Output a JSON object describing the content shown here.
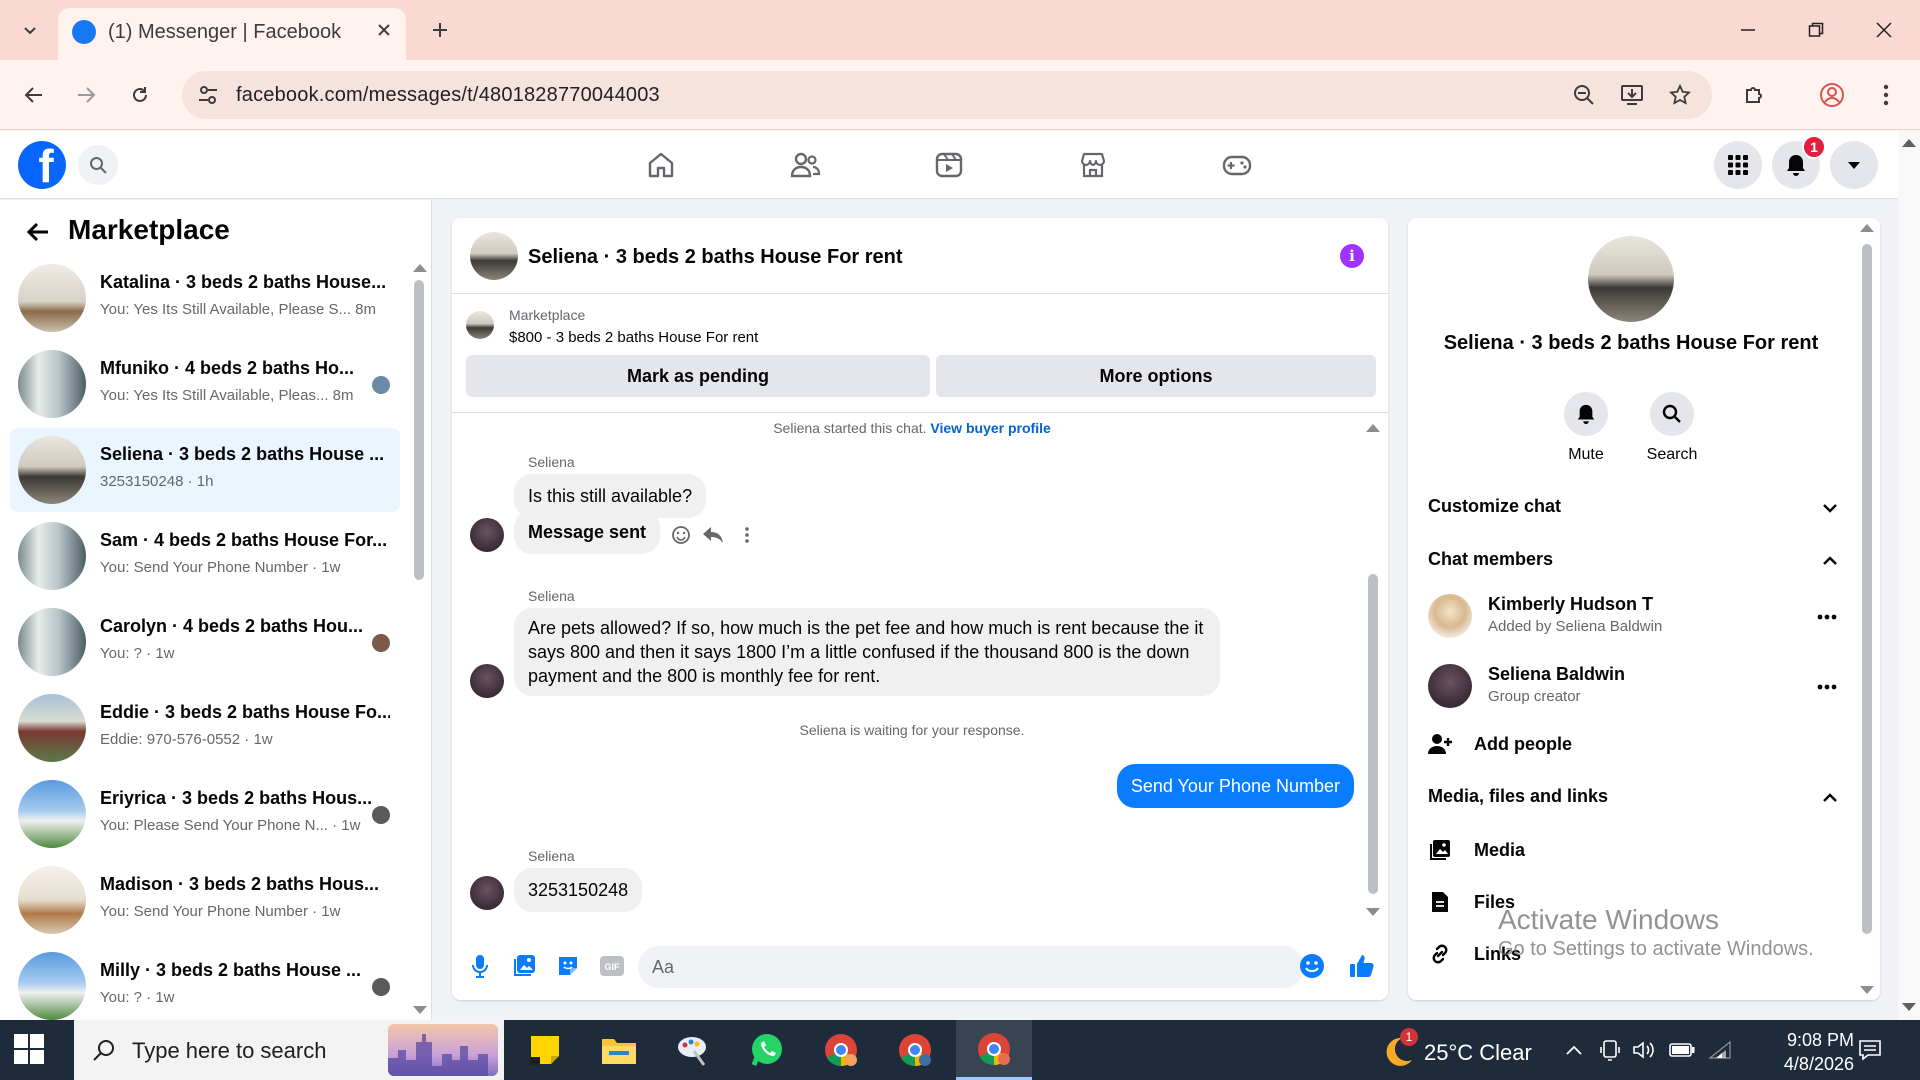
{
  "browser": {
    "tab_title": "(1) Messenger | Facebook",
    "url": "facebook.com/messages/t/4801828770044003"
  },
  "fb_header": {
    "notification_count": "1",
    "logo_letter": "f"
  },
  "left_panel": {
    "title": "Marketplace",
    "conversations": [
      {
        "name": "Katalina · 3 beds 2 baths House...",
        "preview": "You: Yes Its Still Available, Please S... 8m"
      },
      {
        "name": "Mfuniko · 4 beds 2 baths Ho...",
        "preview": "You: Yes Its Still Available, Pleas... 8m"
      },
      {
        "name": "Seliena · 3 beds 2 baths House ...",
        "preview": "3253150248 · 1h"
      },
      {
        "name": "Sam · 4 beds 2 baths House For...",
        "preview": "You: Send Your Phone Number · 1w"
      },
      {
        "name": "Carolyn · 4 beds 2 baths Hou...",
        "preview": "You: ? · 1w"
      },
      {
        "name": "Eddie · 3 beds 2 baths House Fo...",
        "preview": "Eddie: 970-576-0552 · 1w"
      },
      {
        "name": "Eriyrica · 3 beds 2 baths Hous...",
        "preview": "You: Please Send Your Phone N... · 1w"
      },
      {
        "name": "Madison · 3 beds 2 baths Hous...",
        "preview": "You: Send Your Phone Number · 1w"
      },
      {
        "name": "Milly · 3 beds 2 baths House ...",
        "preview": "You: ? · 1w"
      }
    ]
  },
  "chat": {
    "title": "Seliena · 3 beds 2 baths House For rent",
    "marketplace_label": "Marketplace",
    "listing": "$800 - 3 beds 2 baths House For rent",
    "mark_pending": "Mark as pending",
    "more_options": "More options",
    "started_text": "Seliena started this chat.",
    "view_buyer_profile": "View buyer profile",
    "sender_name": "Seliena",
    "msg1": "Is this still available?",
    "msg2": "Message sent",
    "msg3": "Are pets allowed? If so, how much is the pet fee and how much is rent because the it says 800 and then it says 1800 I’m a little confused if the thousand 800 is the down payment and the 800 is monthly fee for rent.",
    "waiting_text": "Seliena is waiting for your response.",
    "msg_out": "Send Your Phone Number",
    "msg4": "3253150248",
    "input_placeholder": "Aa"
  },
  "right_panel": {
    "title": "Seliena · 3 beds 2 baths House For rent",
    "mute": "Mute",
    "search": "Search",
    "customize_chat": "Customize chat",
    "chat_members": "Chat members",
    "members": [
      {
        "name": "Kimberly Hudson T",
        "role": "Added by Seliena Baldwin"
      },
      {
        "name": "Seliena Baldwin",
        "role": "Group creator"
      }
    ],
    "add_people": "Add people",
    "media_section": "Media, files and links",
    "media": "Media",
    "files": "Files",
    "links": "Links"
  },
  "watermark": {
    "title": "Activate Windows",
    "subtitle": "Go to Settings to activate Windows."
  },
  "taskbar": {
    "search_placeholder": "Type here to search",
    "weather": "25°C  Clear",
    "weather_badge": "1",
    "time": "9:08 PM",
    "date": "4/8/2026"
  },
  "colors": {
    "fb_blue": "#0866ff",
    "messenger_blue": "#0a7cff",
    "info_purple": "#a033ff",
    "notification_red": "#e41e3f"
  }
}
